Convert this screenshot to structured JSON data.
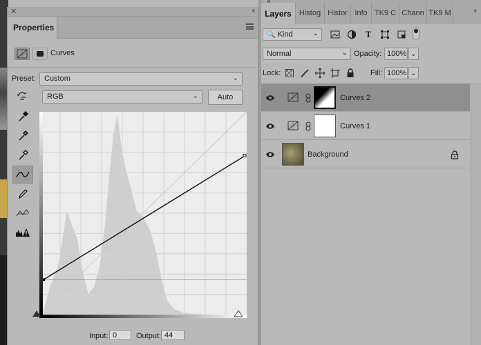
{
  "properties": {
    "tab_title": "Properties",
    "adjustment_title": "Curves",
    "preset_label": "Preset:",
    "preset_value": "Custom",
    "channel_value": "RGB",
    "auto_button": "Auto",
    "input_label": "Input:",
    "input_value": "0",
    "output_label": "Output:",
    "output_value": "44"
  },
  "layers": {
    "tabs": [
      "Layers",
      "Histog",
      "Histor",
      "Info",
      "TK9 C",
      "Chann",
      "TK9 M"
    ],
    "filter_kind": "Kind",
    "blend_mode": "Normal",
    "opacity_label": "Opacity:",
    "opacity_value": "100%",
    "lock_label": "Lock:",
    "fill_label": "Fill:",
    "fill_value": "100%",
    "items": [
      {
        "name": "Curves 2",
        "selected": true
      },
      {
        "name": "Curves 1",
        "selected": false
      },
      {
        "name": "Background",
        "selected": false
      }
    ]
  },
  "icons": [
    "close-icon",
    "collapse-icon",
    "panel-menu-icon",
    "curves-adjustment-icon",
    "mask-icon",
    "targeted-adjustment-icon",
    "black-point-eyedropper-icon",
    "gray-point-eyedropper-icon",
    "white-point-eyedropper-icon",
    "curve-points-icon",
    "pencil-icon",
    "smooth-icon",
    "clipping-warning-icon",
    "search-icon",
    "image-filter-icon",
    "adjustment-filter-icon",
    "type-filter-icon",
    "shape-filter-icon",
    "smart-object-filter-icon",
    "filter-toggle-icon",
    "lock-transparent-icon",
    "lock-image-icon",
    "lock-position-icon",
    "lock-artboard-icon",
    "lock-all-icon",
    "eye-icon",
    "link-icon",
    "padlock-icon"
  ]
}
